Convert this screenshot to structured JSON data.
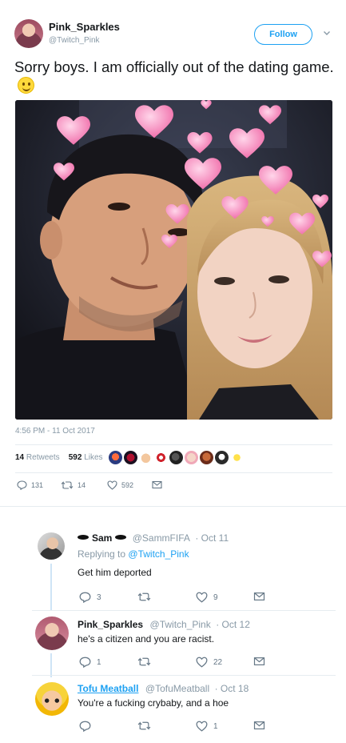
{
  "tweet": {
    "display_name": "Pink_Sparkles",
    "handle": "@Twitch_Pink",
    "follow_label": "Follow",
    "text": "Sorry boys. I am officially out of the dating game.",
    "timestamp": "4:56 PM - 11 Oct 2017",
    "retweets_count": "14",
    "retweets_label": "Retweets",
    "likes_count": "592",
    "likes_label": "Likes",
    "actions": {
      "replies": "131",
      "retweets": "14",
      "likes": "592"
    }
  },
  "colors": {
    "accent": "#1da1f2",
    "muted": "#8899a6",
    "text": "#14171a",
    "divider": "#e6ecf0"
  },
  "replies": [
    {
      "display_name": "Sam",
      "handle": "@SammFIFA",
      "date": "· Oct 11",
      "replying_to_label": "Replying to",
      "replying_to_handle": "@Twitch_Pink",
      "text": "Get him deported",
      "replies": "3",
      "retweets": "",
      "likes": "9"
    },
    {
      "display_name": "Pink_Sparkles",
      "handle": "@Twitch_Pink",
      "date": "· Oct 12",
      "text": "he's a citizen and you are racist.",
      "replies": "1",
      "retweets": "",
      "likes": "22"
    },
    {
      "display_name": "Tofu Meatball",
      "handle": "@TofuMeatball",
      "date": "· Oct 18",
      "text": "You're a fucking crybaby, and a hoe",
      "replies": "",
      "retweets": "",
      "likes": "1"
    }
  ],
  "icons": {
    "reply": "reply-icon",
    "retweet": "retweet-icon",
    "like": "heart-icon",
    "dm": "envelope-icon",
    "more": "chevron-down-icon"
  }
}
